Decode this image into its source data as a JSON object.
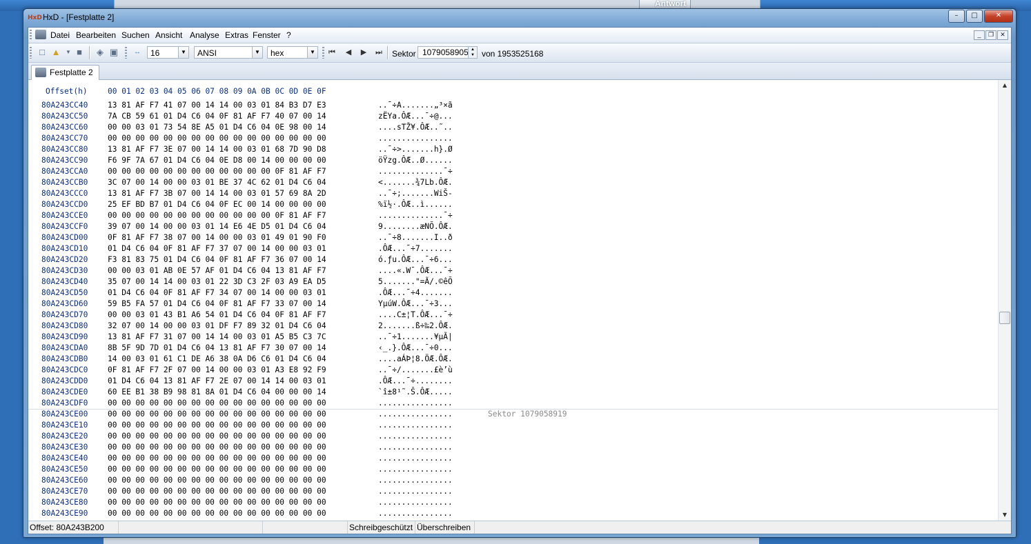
{
  "desktop": {
    "background_button": "Antwort"
  },
  "window": {
    "title": "HxD - [Festplatte 2]",
    "controls": {
      "minimize": "–",
      "maximize": "□",
      "close": "✕"
    }
  },
  "menu": {
    "items": [
      "Datei",
      "Bearbeiten",
      "Suchen",
      "Ansicht",
      "Analyse",
      "Extras",
      "Fenster",
      "?"
    ],
    "mdi_controls": {
      "minimize": "_",
      "restore": "❐",
      "close": "✕"
    }
  },
  "toolbar": {
    "bytes_per_row": "16",
    "charset": "ANSI",
    "offset_base": "hex",
    "sector_label": "Sektor",
    "sector_value": "1079058905",
    "sector_total": "von 1953525168"
  },
  "tabs": [
    {
      "label": "Festplatte 2"
    }
  ],
  "hex_view": {
    "header_offset": "Offset(h)",
    "header_columns": "00 01 02 03 04 05 06 07 08 09 0A 0B 0C 0D 0E 0F",
    "sector_boundary_label": "Sektor 1079058919",
    "rows": [
      {
        "offset": "80A243CC40",
        "hex": "13 81 AF F7 41 07 00 14 14 00 03 01 84 B3 D7 E3",
        "text": "..¯÷A.......„³×ã"
      },
      {
        "offset": "80A243CC50",
        "hex": "7A CB 59 61 01 D4 C6 04 0F 81 AF F7 40 07 00 14",
        "text": "zËYa.ÔÆ...¯÷@..."
      },
      {
        "offset": "80A243CC60",
        "hex": "00 00 03 01 73 54 8E A5 01 D4 C6 04 0E 98 00 14",
        "text": "....sTŽ¥.ÔÆ..˜.."
      },
      {
        "offset": "80A243CC70",
        "hex": "00 00 00 00 00 00 00 00 00 00 00 00 00 00 00 00",
        "text": "................"
      },
      {
        "offset": "80A243CC80",
        "hex": "13 81 AF F7 3E 07 00 14 14 00 03 01 68 7D 90 D8",
        "text": "..¯÷>.......h}.Ø"
      },
      {
        "offset": "80A243CC90",
        "hex": "F6 9F 7A 67 01 D4 C6 04 0E D8 00 14 00 00 00 00",
        "text": "öŸzg.ÔÆ..Ø......"
      },
      {
        "offset": "80A243CCA0",
        "hex": "00 00 00 00 00 00 00 00 00 00 00 00 0F 81 AF F7",
        "text": "..............¯÷"
      },
      {
        "offset": "80A243CCB0",
        "hex": "3C 07 00 14 00 00 03 01 BE 37 4C 62 01 D4 C6 04",
        "text": "<.......¾7Lb.ÔÆ."
      },
      {
        "offset": "80A243CCC0",
        "hex": "13 81 AF F7 3B 07 00 14 14 00 03 01 57 69 8A 2D",
        "text": "..¯÷;.......WiŠ-"
      },
      {
        "offset": "80A243CCD0",
        "hex": "25 EF BD B7 01 D4 C6 04 0F EC 00 14 00 00 00 00",
        "text": "%ï½·.ÔÆ..ì......"
      },
      {
        "offset": "80A243CCE0",
        "hex": "00 00 00 00 00 00 00 00 00 00 00 00 0F 81 AF F7",
        "text": "..............¯÷"
      },
      {
        "offset": "80A243CCF0",
        "hex": "39 07 00 14 00 00 03 01 14 E6 4E D5 01 D4 C6 04",
        "text": "9........æNÕ.ÔÆ."
      },
      {
        "offset": "80A243CD00",
        "hex": "0F 81 AF F7 38 07 00 14 00 00 03 01 49 01 90 F0",
        "text": "..¯÷8.......I..ð"
      },
      {
        "offset": "80A243CD10",
        "hex": "01 D4 C6 04 0F 81 AF F7 37 07 00 14 00 00 03 01",
        "text": ".ÔÆ...¯÷7......."
      },
      {
        "offset": "80A243CD20",
        "hex": "F3 81 83 75 01 D4 C6 04 0F 81 AF F7 36 07 00 14",
        "text": "ó.ƒu.ÔÆ...¯÷6..."
      },
      {
        "offset": "80A243CD30",
        "hex": "00 00 03 01 AB 0E 57 AF 01 D4 C6 04 13 81 AF F7",
        "text": "....«.W¯.ÔÆ...¯÷"
      },
      {
        "offset": "80A243CD40",
        "hex": "35 07 00 14 14 00 03 01 22 3D C3 2F 03 A9 EA D5",
        "text": "5.......\"=Ã/.©êÕ"
      },
      {
        "offset": "80A243CD50",
        "hex": "01 D4 C6 04 0F 81 AF F7 34 07 00 14 00 00 03 01",
        "text": ".ÔÆ...¯÷4......."
      },
      {
        "offset": "80A243CD60",
        "hex": "59 B5 FA 57 01 D4 C6 04 0F 81 AF F7 33 07 00 14",
        "text": "YµúW.ÔÆ...¯÷3..."
      },
      {
        "offset": "80A243CD70",
        "hex": "00 00 03 01 43 B1 A6 54 01 D4 C6 04 0F 81 AF F7",
        "text": "....C±¦T.ÔÆ...¯÷"
      },
      {
        "offset": "80A243CD80",
        "hex": "32 07 00 14 00 00 03 01 DF F7 89 32 01 D4 C6 04",
        "text": "2.......ß÷‰2.ÔÆ."
      },
      {
        "offset": "80A243CD90",
        "hex": "13 81 AF F7 31 07 00 14 14 00 03 01 A5 B5 C3 7C",
        "text": "..¯÷1.......¥µÃ|"
      },
      {
        "offset": "80A243CDA0",
        "hex": "8B 5F 9D 7D 01 D4 C6 04 13 81 AF F7 30 07 00 14",
        "text": "‹_.}.ÔÆ...¯÷0..."
      },
      {
        "offset": "80A243CDB0",
        "hex": "14 00 03 01 61 C1 DE A6 38 0A D6 C6 01 D4 C6 04",
        "text": "....aÁÞ¦8.ÖÆ.ÔÆ."
      },
      {
        "offset": "80A243CDC0",
        "hex": "0F 81 AF F7 2F 07 00 14 00 00 03 01 A3 E8 92 F9",
        "text": "..¯÷/.......£è’ù"
      },
      {
        "offset": "80A243CDD0",
        "hex": "01 D4 C6 04 13 81 AF F7 2E 07 00 14 14 00 03 01",
        "text": ".ÔÆ...¯÷........"
      },
      {
        "offset": "80A243CDE0",
        "hex": "60 EE B1 38 B9 98 81 8A 01 D4 C6 04 00 00 00 14",
        "text": "`î±8¹˜.Š.ÔÆ....."
      },
      {
        "offset": "80A243CDF0",
        "hex": "00 00 00 00 00 00 00 00 00 00 00 00 00 00 00 00",
        "text": "................"
      },
      {
        "offset": "80A243CE00",
        "hex": "00 00 00 00 00 00 00 00 00 00 00 00 00 00 00 00",
        "text": "................"
      },
      {
        "offset": "80A243CE10",
        "hex": "00 00 00 00 00 00 00 00 00 00 00 00 00 00 00 00",
        "text": "................"
      },
      {
        "offset": "80A243CE20",
        "hex": "00 00 00 00 00 00 00 00 00 00 00 00 00 00 00 00",
        "text": "................"
      },
      {
        "offset": "80A243CE30",
        "hex": "00 00 00 00 00 00 00 00 00 00 00 00 00 00 00 00",
        "text": "................"
      },
      {
        "offset": "80A243CE40",
        "hex": "00 00 00 00 00 00 00 00 00 00 00 00 00 00 00 00",
        "text": "................"
      },
      {
        "offset": "80A243CE50",
        "hex": "00 00 00 00 00 00 00 00 00 00 00 00 00 00 00 00",
        "text": "................"
      },
      {
        "offset": "80A243CE60",
        "hex": "00 00 00 00 00 00 00 00 00 00 00 00 00 00 00 00",
        "text": "................"
      },
      {
        "offset": "80A243CE70",
        "hex": "00 00 00 00 00 00 00 00 00 00 00 00 00 00 00 00",
        "text": "................"
      },
      {
        "offset": "80A243CE80",
        "hex": "00 00 00 00 00 00 00 00 00 00 00 00 00 00 00 00",
        "text": "................"
      },
      {
        "offset": "80A243CE90",
        "hex": "00 00 00 00 00 00 00 00 00 00 00 00 00 00 00 00",
        "text": "................"
      }
    ]
  },
  "statusbar": {
    "offset": "Offset: 80A243B200",
    "readonly": "Schreibgeschützt",
    "mode": "Überschreiben"
  },
  "colors": {
    "offset_blue": "#0b2e8a",
    "sector_label_gray": "#8a8a8a",
    "window_frame": "#7aa6d4",
    "close_red": "#c5422a"
  }
}
